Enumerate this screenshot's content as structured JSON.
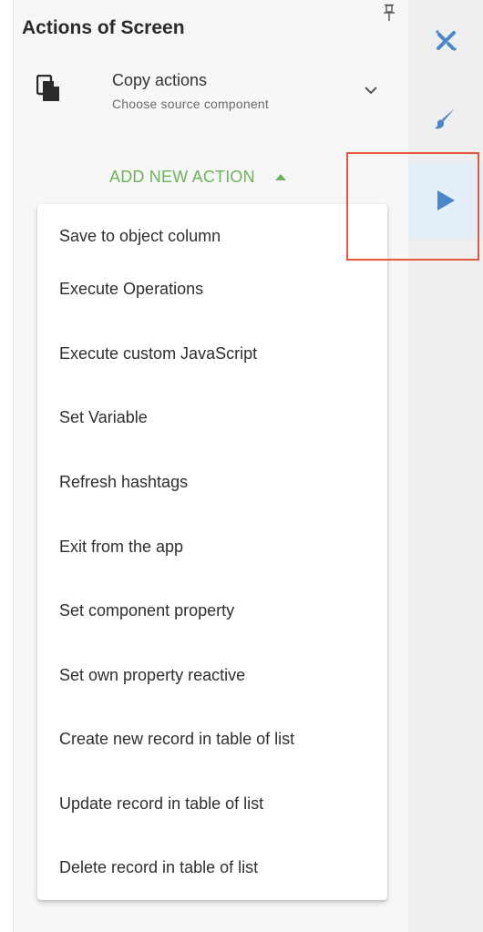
{
  "panel": {
    "title_prefix": "Actions of ",
    "title_bold": "Screen",
    "pin_icon": "pin-icon"
  },
  "copy_actions": {
    "title": "Copy actions",
    "subtitle": "Choose source component",
    "icon": "copy-icon",
    "chevron_icon": "chevron-down-icon"
  },
  "add_action": {
    "label": "ADD NEW ACTION",
    "icon": "caret-up-icon",
    "color": "#6cb35b"
  },
  "menu": {
    "items": [
      "Save to object column",
      "Execute Operations",
      "Execute custom JavaScript",
      "Set Variable",
      "Refresh hashtags",
      "Exit from the app",
      "Set component property",
      "Set own property reactive",
      "Create new record in table of list",
      "Update record in table of list",
      "Delete record in table of list"
    ]
  },
  "rail": {
    "items": [
      {
        "icon": "magic-tools-icon",
        "active": false
      },
      {
        "icon": "brush-icon",
        "active": false
      },
      {
        "icon": "play-icon",
        "active": true
      }
    ],
    "accent": "#4a86c8"
  },
  "highlight_color": "#e4583e"
}
